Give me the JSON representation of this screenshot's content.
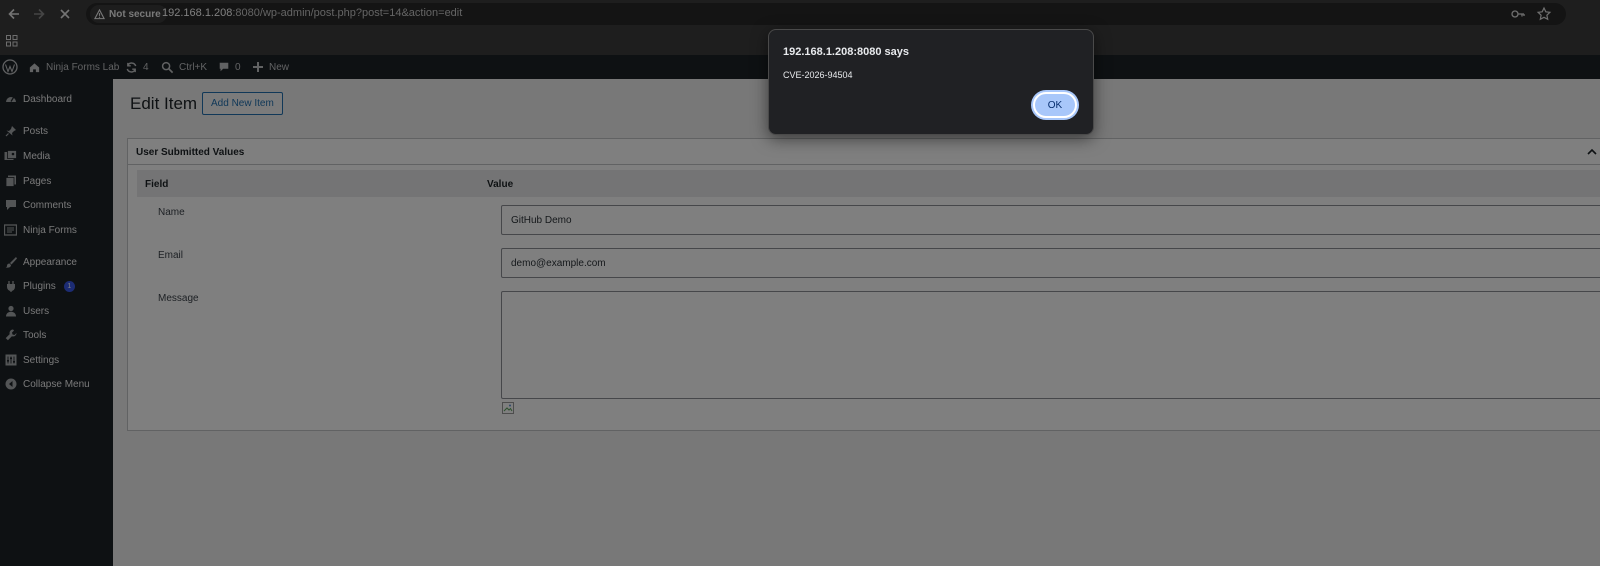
{
  "browser": {
    "security_label": "Not secure",
    "url_host": "192.168.1.208",
    "url_rest": ":8080/wp-admin/post.php?post=14&action=edit"
  },
  "admin_bar": {
    "site_name": "Ninja Forms Lab",
    "updates_count": "4",
    "search_shortcut": "Ctrl+K",
    "comments_count": "0",
    "new_label": "New"
  },
  "sidebar": {
    "items": [
      {
        "label": "Dashboard",
        "icon": "dashboard-icon"
      },
      {
        "label": "Posts",
        "icon": "pin-icon"
      },
      {
        "label": "Media",
        "icon": "media-icon"
      },
      {
        "label": "Pages",
        "icon": "pages-icon"
      },
      {
        "label": "Comments",
        "icon": "comment-icon"
      },
      {
        "label": "Ninja Forms",
        "icon": "forms-icon"
      },
      {
        "label": "Appearance",
        "icon": "brush-icon"
      },
      {
        "label": "Plugins",
        "icon": "plugin-icon",
        "badge": "1"
      },
      {
        "label": "Users",
        "icon": "user-icon"
      },
      {
        "label": "Tools",
        "icon": "wrench-icon"
      },
      {
        "label": "Settings",
        "icon": "settings-icon"
      },
      {
        "label": "Collapse Menu",
        "icon": "collapse-icon"
      }
    ]
  },
  "main": {
    "title": "Edit Item",
    "add_new_label": "Add New Item",
    "box_title": "User Submitted Values",
    "col_field": "Field",
    "col_value": "Value",
    "fields": [
      {
        "label": "Name",
        "value": "GitHub Demo"
      },
      {
        "label": "Email",
        "value": "demo@example.com"
      },
      {
        "label": "Message",
        "value": ""
      }
    ]
  },
  "dialog": {
    "title": "192.168.1.208:8080 says",
    "message": "CVE-2026-94504",
    "ok_label": "OK"
  },
  "colors": {
    "admin_dark": "#1d2327",
    "accent": "#2271b1",
    "dialog_bg": "#202124",
    "ok_button": "#a8c7fa"
  }
}
